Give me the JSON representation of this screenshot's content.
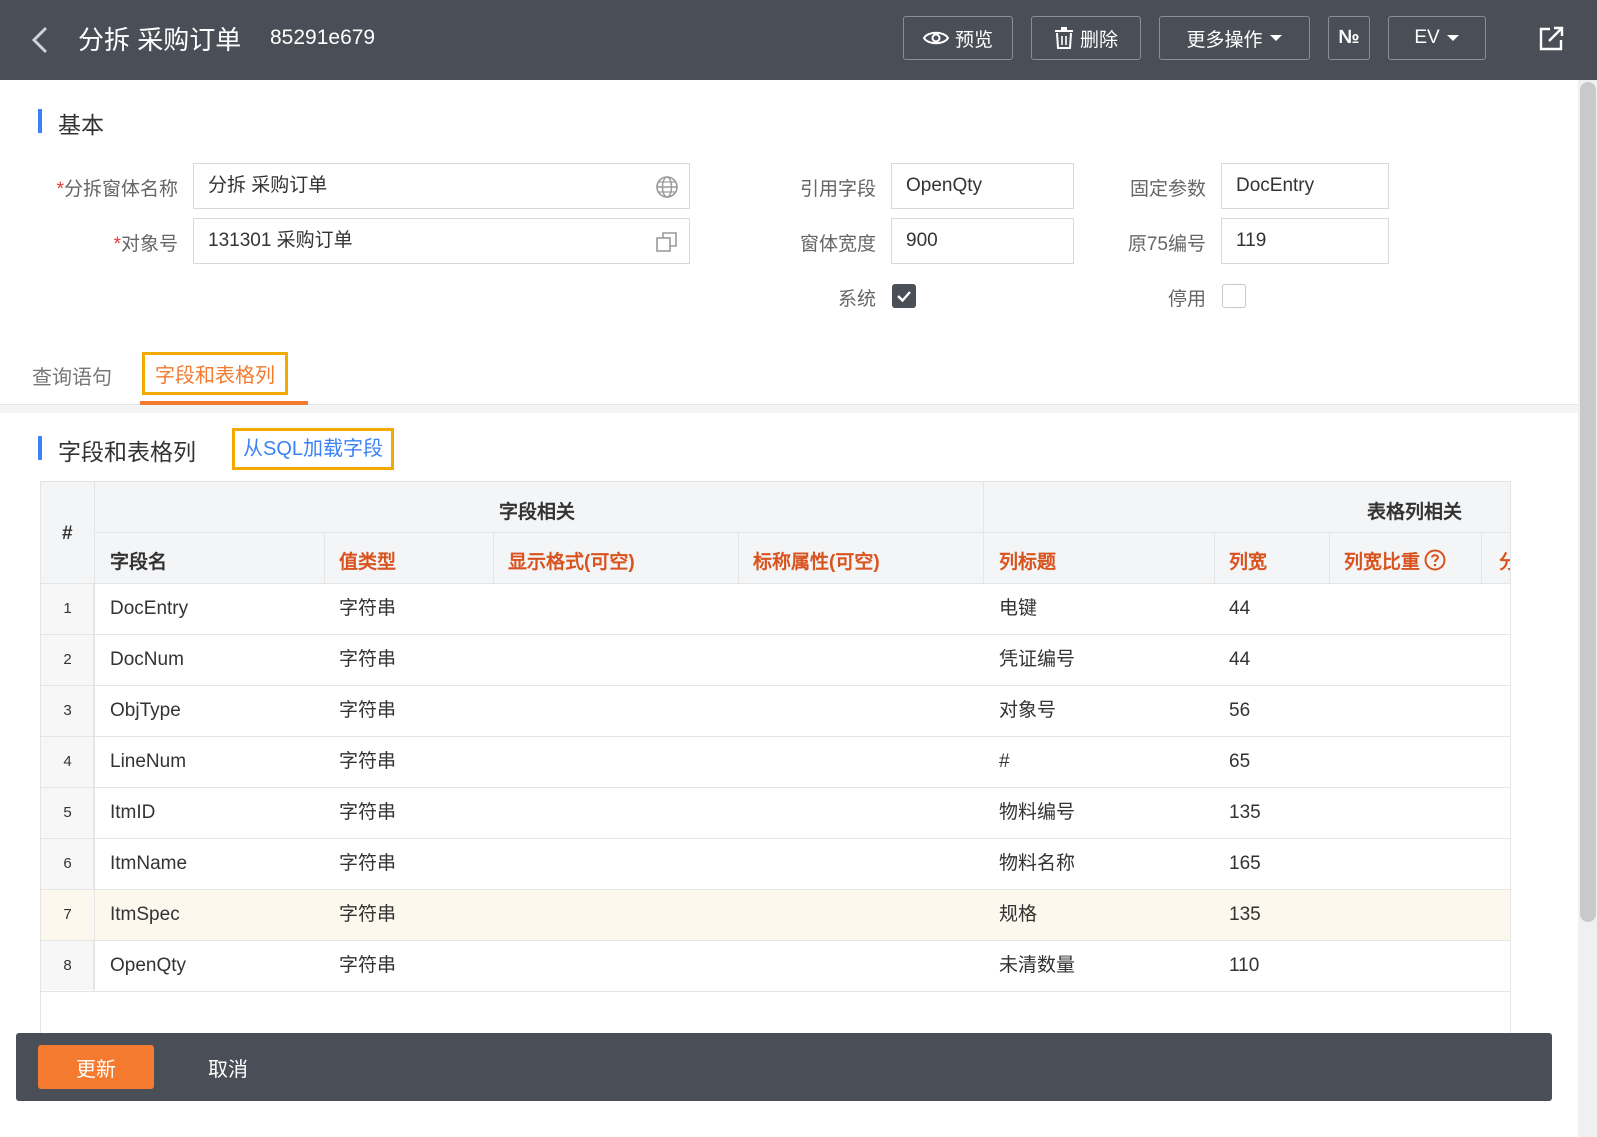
{
  "header": {
    "title": "分拆 采购订单",
    "subtitle": "85291e679",
    "preview_label": "预览",
    "delete_label": "删除",
    "more_label": "更多操作",
    "numero_label": "№",
    "ev_label": "EV"
  },
  "basic": {
    "section_title": "基本",
    "fields": {
      "name_label": "分拆窗体名称",
      "name_value": "分拆 采购订单",
      "object_label": "对象号",
      "object_value": "131301 采购订单",
      "ref_field_label": "引用字段",
      "ref_field_value": "OpenQty",
      "fixed_param_label": "固定参数",
      "fixed_param_value": "DocEntry",
      "width_label": "窗体宽度",
      "width_value": "900",
      "orig75_label": "原75编号",
      "orig75_value": "119",
      "system_label": "系统",
      "system_checked": true,
      "disabled_label": "停用",
      "disabled_checked": false
    }
  },
  "tabs": [
    {
      "label": "查询语句",
      "active": false
    },
    {
      "label": "字段和表格列",
      "active": true
    }
  ],
  "fields_section": {
    "title": "字段和表格列",
    "load_sql_label": "从SQL加载字段"
  },
  "table": {
    "group_headers": {
      "index": "#",
      "field_group": "字段相关",
      "column_group": "表格列相关"
    },
    "columns": {
      "field_name": "字段名",
      "value_type": "值类型",
      "display_format": "显示格式(可空)",
      "title_attr": "标称属性(可空)",
      "column_title": "列标题",
      "column_width": "列宽",
      "column_ratio": "列宽比重",
      "partial": "分"
    },
    "rows": [
      {
        "index": "1",
        "field_name": "DocEntry",
        "value_type": "字符串",
        "column_title": "电键",
        "column_width": "44"
      },
      {
        "index": "2",
        "field_name": "DocNum",
        "value_type": "字符串",
        "column_title": "凭证编号",
        "column_width": "44"
      },
      {
        "index": "3",
        "field_name": "ObjType",
        "value_type": "字符串",
        "column_title": "对象号",
        "column_width": "56"
      },
      {
        "index": "4",
        "field_name": "LineNum",
        "value_type": "字符串",
        "column_title": "#",
        "column_width": "65"
      },
      {
        "index": "5",
        "field_name": "ItmID",
        "value_type": "字符串",
        "column_title": "物料编号",
        "column_width": "135"
      },
      {
        "index": "6",
        "field_name": "ItmName",
        "value_type": "字符串",
        "column_title": "物料名称",
        "column_width": "165"
      },
      {
        "index": "7",
        "field_name": "ItmSpec",
        "value_type": "字符串",
        "column_title": "规格",
        "column_width": "135"
      },
      {
        "index": "8",
        "field_name": "OpenQty",
        "value_type": "字符串",
        "column_title": "未清数量",
        "column_width": "110"
      }
    ]
  },
  "footer": {
    "update_label": "更新",
    "cancel_label": "取消"
  },
  "colors": {
    "header_bg": "#4a4f57",
    "accent_orange": "#f47a2f",
    "highlight_box": "#f2a900",
    "link_blue": "#3b82f6",
    "header_text_accent": "#d9531e"
  }
}
